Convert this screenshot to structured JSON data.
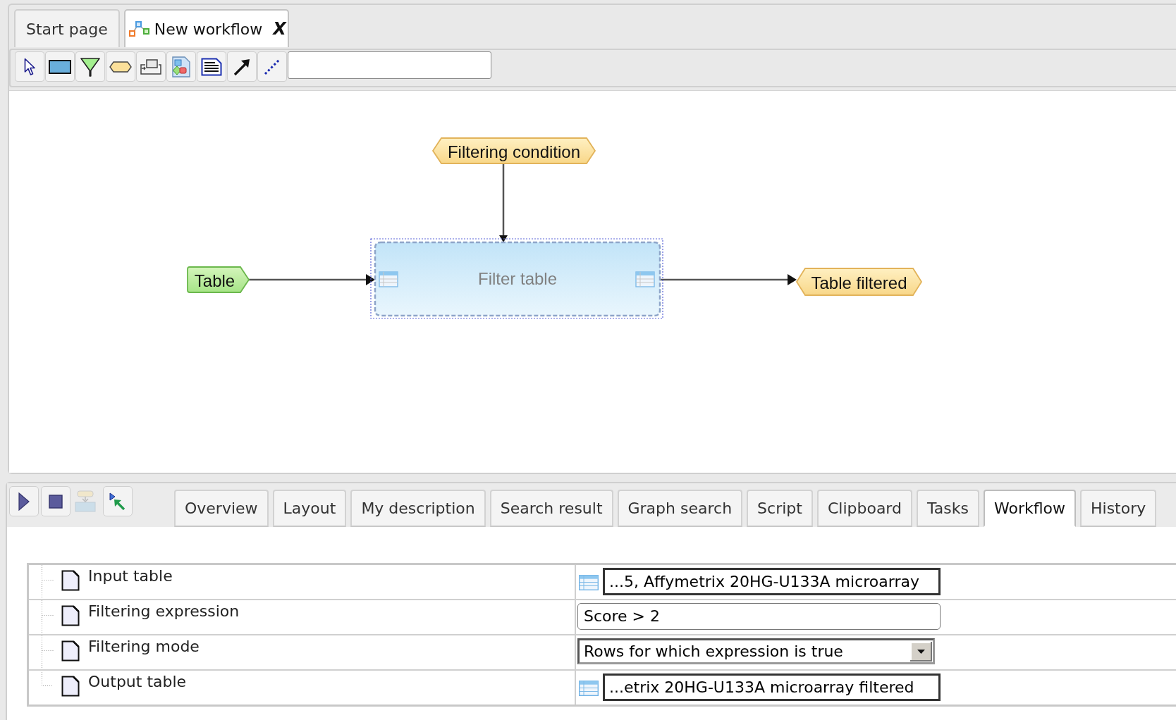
{
  "tabs": [
    {
      "label": "Start page",
      "kind": "page",
      "selected": false
    },
    {
      "label": "New workflow",
      "kind": "workflow",
      "selected": true,
      "close": "X"
    }
  ],
  "diagram": {
    "nodes": [
      {
        "kind": "parameter",
        "label": "Filtering condition",
        "selected": false
      },
      {
        "kind": "input",
        "label": "Table",
        "selected": false
      },
      {
        "kind": "process",
        "label": "Filter table",
        "selected": true
      },
      {
        "kind": "output",
        "label": "Table filtered",
        "selected": false
      }
    ]
  },
  "panel_toolbar": {
    "buttons": [
      {
        "disabled": false
      },
      {
        "disabled": false
      },
      {
        "disabled": true
      },
      {
        "disabled": false
      }
    ]
  },
  "panel_tabs": [
    {
      "label": "Overview",
      "selected": false
    },
    {
      "label": "Layout",
      "selected": false
    },
    {
      "label": "My description",
      "selected": false
    },
    {
      "label": "Search result",
      "selected": false
    },
    {
      "label": "Graph search",
      "selected": false
    },
    {
      "label": "Script",
      "selected": false
    },
    {
      "label": "Clipboard",
      "selected": false
    },
    {
      "label": "Tasks",
      "selected": false
    },
    {
      "label": "Workflow",
      "selected": true
    },
    {
      "label": "History",
      "selected": false
    }
  ],
  "properties": [
    {
      "label": "Input table",
      "kind": "table",
      "value": "...5, Affymetrix 20HG-U133A microarray"
    },
    {
      "label": "Filtering expression",
      "kind": "text",
      "value": "Score > 2"
    },
    {
      "label": "Filtering mode",
      "kind": "select",
      "value": "Rows for which expression is true"
    },
    {
      "label": "Output table",
      "kind": "table",
      "value": "...etrix 20HG-U133A microarray filtered"
    }
  ]
}
